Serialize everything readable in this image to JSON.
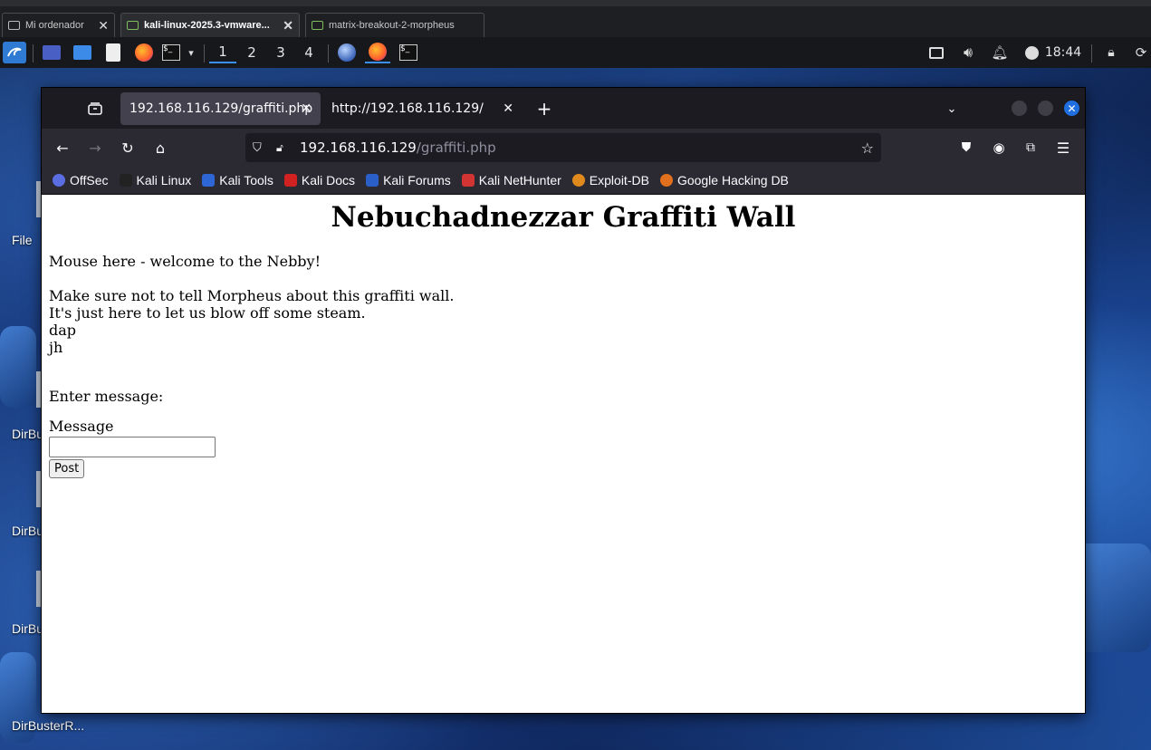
{
  "host_tabs": [
    {
      "label": "Mi ordenador",
      "active": false
    },
    {
      "label": "kali-linux-2025.3-vmware...",
      "active": true
    },
    {
      "label": "matrix-breakout-2-morpheus",
      "active": false
    }
  ],
  "panel": {
    "workspaces": [
      "1",
      "2",
      "3",
      "4"
    ],
    "active_workspace": "1",
    "clock": "18:44"
  },
  "desktop_labels": [
    "File",
    "DirBu",
    "DirBu",
    "DirBu",
    "DirBusterR..."
  ],
  "browser": {
    "tabs": [
      {
        "label": "192.168.116.129/graffiti.php",
        "active": true
      },
      {
        "label": "http://192.168.116.129/",
        "active": false
      }
    ],
    "url_host": "192.168.116.129",
    "url_path": "/graffiti.php",
    "bookmarks": [
      {
        "label": "OffSec",
        "icon": "offsec-icon",
        "color": "#5b6ee1"
      },
      {
        "label": "Kali Linux",
        "icon": "kali-dragon-icon",
        "color": "#222222"
      },
      {
        "label": "Kali Tools",
        "icon": "kali-tools-icon",
        "color": "#2f66d6"
      },
      {
        "label": "Kali Docs",
        "icon": "kali-docs-icon",
        "color": "#d22121"
      },
      {
        "label": "Kali Forums",
        "icon": "kali-forums-icon",
        "color": "#2b5fc8"
      },
      {
        "label": "Kali NetHunter",
        "icon": "nethunter-icon",
        "color": "#d23434"
      },
      {
        "label": "Exploit-DB",
        "icon": "exploitdb-icon",
        "color": "#e08a1e"
      },
      {
        "label": "Google Hacking DB",
        "icon": "ghdb-icon",
        "color": "#e0701e"
      }
    ]
  },
  "page": {
    "title": "Nebuchadnezzar Graffiti Wall",
    "welcome": "Mouse here - welcome to the Nebby!",
    "wall_lines": [
      "Make sure not to tell Morpheus about this graffiti wall.",
      "It's just here to let us blow off some steam.",
      "dap",
      "jh"
    ],
    "enter_message": "Enter message:",
    "message_label": "Message",
    "message_value": "",
    "post_label": "Post"
  }
}
